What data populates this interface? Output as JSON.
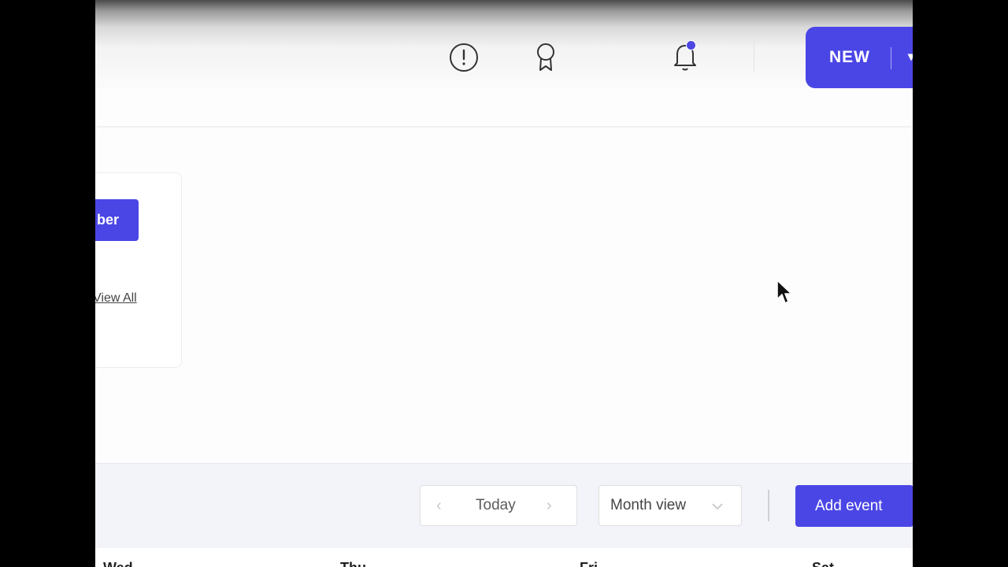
{
  "header": {
    "new_button_label": "NEW",
    "new_button_caret": "▾",
    "icons": [
      "alert-circle-icon",
      "award-ribbon-icon",
      "bell-icon"
    ]
  },
  "card": {
    "button_label": "ber",
    "view_all_link": "View All"
  },
  "calendar": {
    "prev_arrow": "‹",
    "next_arrow": "›",
    "today_label": "Today",
    "view_select_label": "Month view",
    "add_event_label": "Add event",
    "day_headers": [
      "Wed",
      "Thu",
      "Fri",
      "Sat"
    ]
  },
  "colors": {
    "accent": "#4a46e6",
    "toolbar_bg": "#f3f3fa"
  }
}
